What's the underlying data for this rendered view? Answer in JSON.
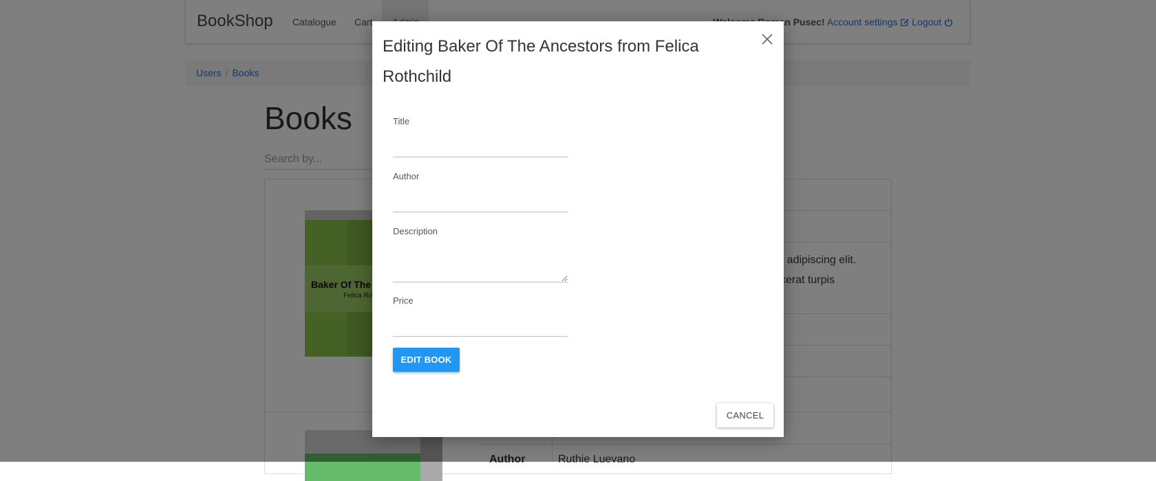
{
  "navbar": {
    "brand": "BookShop",
    "links": [
      "Catalogue",
      "Cart",
      "Admin"
    ],
    "welcome": "Welcome Roman Pusec!",
    "account_settings": "Account settings",
    "logout": "Logout"
  },
  "breadcrumb": [
    "Users",
    "Books"
  ],
  "page": {
    "title": "Books",
    "search_placeholder": "Search by..."
  },
  "book": {
    "cover_title": "Baker Of The",
    "cover_author": "Felica Ro",
    "description_lines": [
      "ur adipiscing elit.",
      "acerat turpis"
    ],
    "next_author_label": "Author",
    "next_author_value": "Ruthie Luevano"
  },
  "modal": {
    "title": "Editing Baker Of The Ancestors from Felica Rothchild",
    "fields": {
      "title_label": "Title",
      "title_value": "",
      "author_label": "Author",
      "author_value": "",
      "description_label": "Description",
      "description_value": "",
      "price_label": "Price",
      "price_value": ""
    },
    "submit_label": "EDIT BOOK",
    "cancel_label": "CANCEL"
  },
  "colors": {
    "primary": "#2196f3",
    "link": "#2a6fc9",
    "cover_green": "#8bc34a"
  }
}
